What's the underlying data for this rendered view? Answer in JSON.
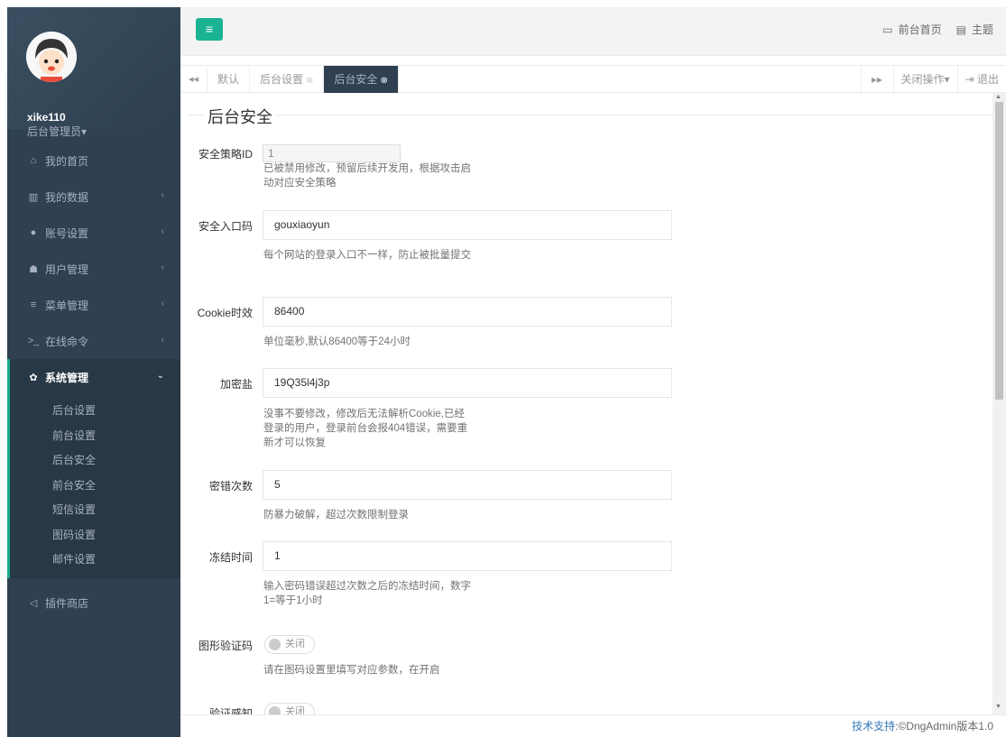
{
  "user": {
    "name": "xike110",
    "role": "后台管理员",
    "role_caret": "▾"
  },
  "sidebar": {
    "items": [
      {
        "label": "我的首页",
        "icon": "home-icon",
        "glyph": "⌂"
      },
      {
        "label": "我的数据",
        "icon": "bar-chart-icon",
        "glyph": "▥",
        "arrow": "‹"
      },
      {
        "label": "账号设置",
        "icon": "user-icon",
        "glyph": "●",
        "arrow": "‹"
      },
      {
        "label": "用户管理",
        "icon": "users-icon",
        "glyph": "☗",
        "arrow": "‹"
      },
      {
        "label": "菜单管理",
        "icon": "list-icon",
        "glyph": "≡",
        "arrow": "‹"
      },
      {
        "label": "在线命令",
        "icon": "terminal-icon",
        "glyph": ">_",
        "arrow": "‹"
      },
      {
        "label": "系统管理",
        "icon": "gear-icon",
        "glyph": "✿",
        "arrow": "⌄"
      }
    ],
    "submenu": [
      "后台设置",
      "前台设置",
      "后台安全",
      "前台安全",
      "短信设置",
      "图码设置",
      "邮件设置"
    ],
    "store": {
      "label": "插件商店",
      "icon": "send-icon",
      "glyph": "◁"
    }
  },
  "topbar": {
    "toggle_glyph": "≡",
    "front_home": "前台首页",
    "front_home_glyph": "▭",
    "theme": "主题",
    "theme_glyph": "▤"
  },
  "tabs": {
    "prev_glyph": "◂◂",
    "next_glyph": "▸▸",
    "items": [
      {
        "label": "默认",
        "close": ""
      },
      {
        "label": "后台设置",
        "close": "⊗"
      },
      {
        "label": "后台安全",
        "close": "⊗"
      }
    ],
    "close_ops": "关闭操作",
    "close_caret": "▾",
    "logout": "退出",
    "logout_glyph": "⇥"
  },
  "form": {
    "section_title": "后台安全",
    "fields": [
      {
        "label": "安全策略ID",
        "value": "1",
        "help": "已被禁用修改，预留后续开发用，根据攻击启动对应安全策略"
      },
      {
        "label": "安全入口码",
        "value": "gouxiaoyun",
        "help": "每个网站的登录入口不一样，防止被批量提交"
      },
      {
        "label": "Cookie时效",
        "value": "86400",
        "help": "单位毫秒,默认86400等于24小时"
      },
      {
        "label": "加密盐",
        "value": "19Q35l4j3p",
        "help": "没事不要修改，修改后无法解析Cookie,已经登录的用户，登录前台会报404错误，需要重新才可以恢复"
      },
      {
        "label": "密错次数",
        "value": "5",
        "help": "防暴力破解，超过次数限制登录"
      },
      {
        "label": "冻结时间",
        "value": "1",
        "help": "输入密码错误超过次数之后的冻结时间，数字1=等于1小时"
      },
      {
        "label": "图形验证码",
        "toggle": "关闭",
        "help": "请在图码设置里填写对应参数，在开启"
      },
      {
        "label": "验证感知",
        "toggle": "关闭",
        "help": ""
      }
    ]
  },
  "footer": {
    "link": "技术支持",
    "text": ":©DngAdmin版本1.0"
  },
  "colors": {
    "sidebar": "#2f4050",
    "accent": "#1ab394",
    "active_border": "#19aa8d"
  }
}
